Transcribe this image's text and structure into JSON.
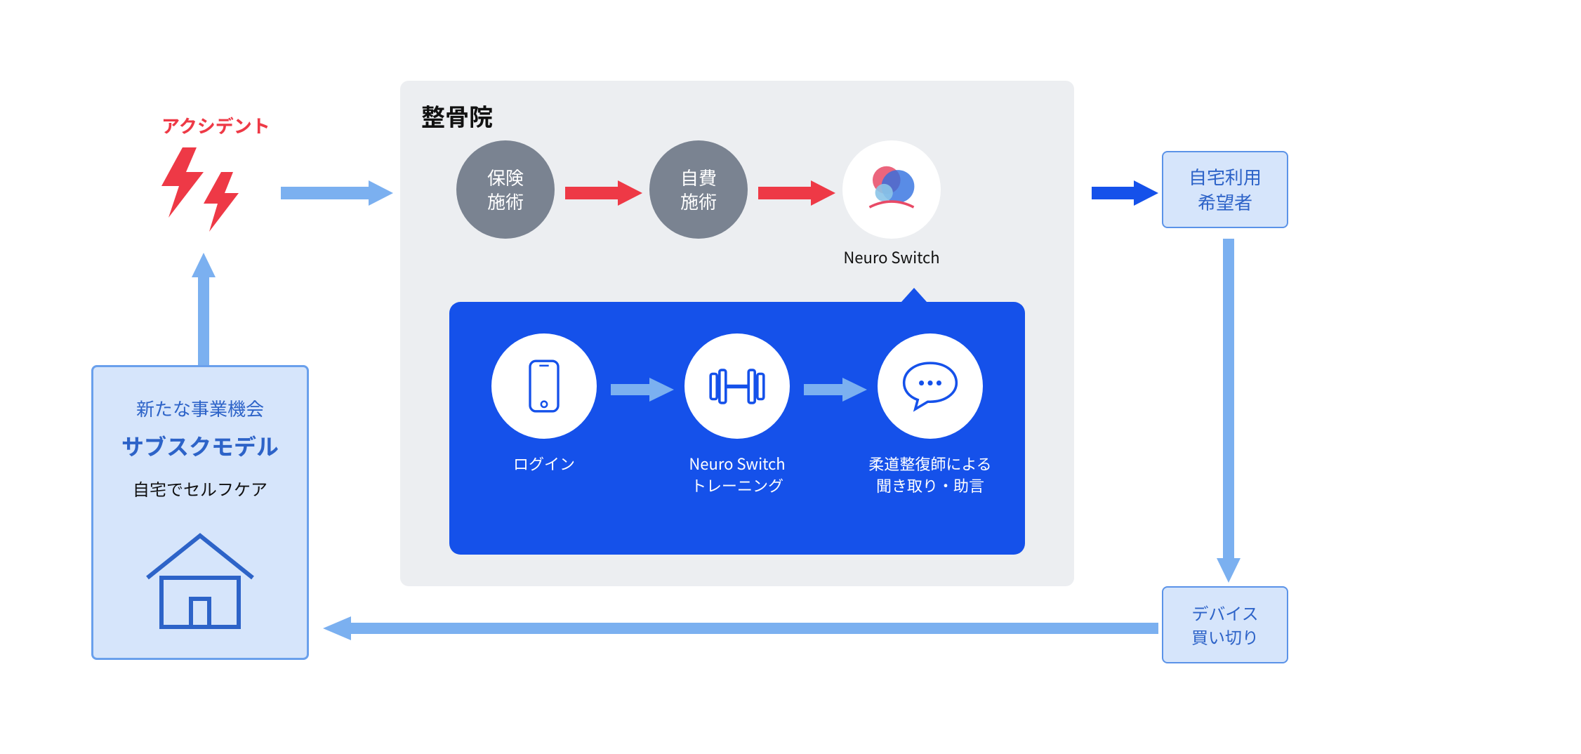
{
  "accident_label": "アクシデント",
  "clinic": {
    "title": "整骨院",
    "node_insurance": "保険\n施術",
    "node_self": "自費\n施術",
    "neuro_label": "Neuro Switch"
  },
  "process": {
    "login": "ログイン",
    "training": "Neuro Switch\nトレーニング",
    "advice": "柔道整復師による\n聞き取り・助言"
  },
  "right": {
    "home_user": "自宅利用\n希望者",
    "device_purchase": "デバイス\n買い切り"
  },
  "opportunity": {
    "line1": "新たな事業機会",
    "line2": "サブスクモデル",
    "line3": "自宅でセルフケア"
  },
  "colors": {
    "red": "#ee3946",
    "blue_bright": "#1551ea",
    "blue_light": "#7bb0f0",
    "blue_medium": "#5b93e8",
    "gray_node": "#7a8391",
    "panel_bg": "#d6e5fb"
  }
}
